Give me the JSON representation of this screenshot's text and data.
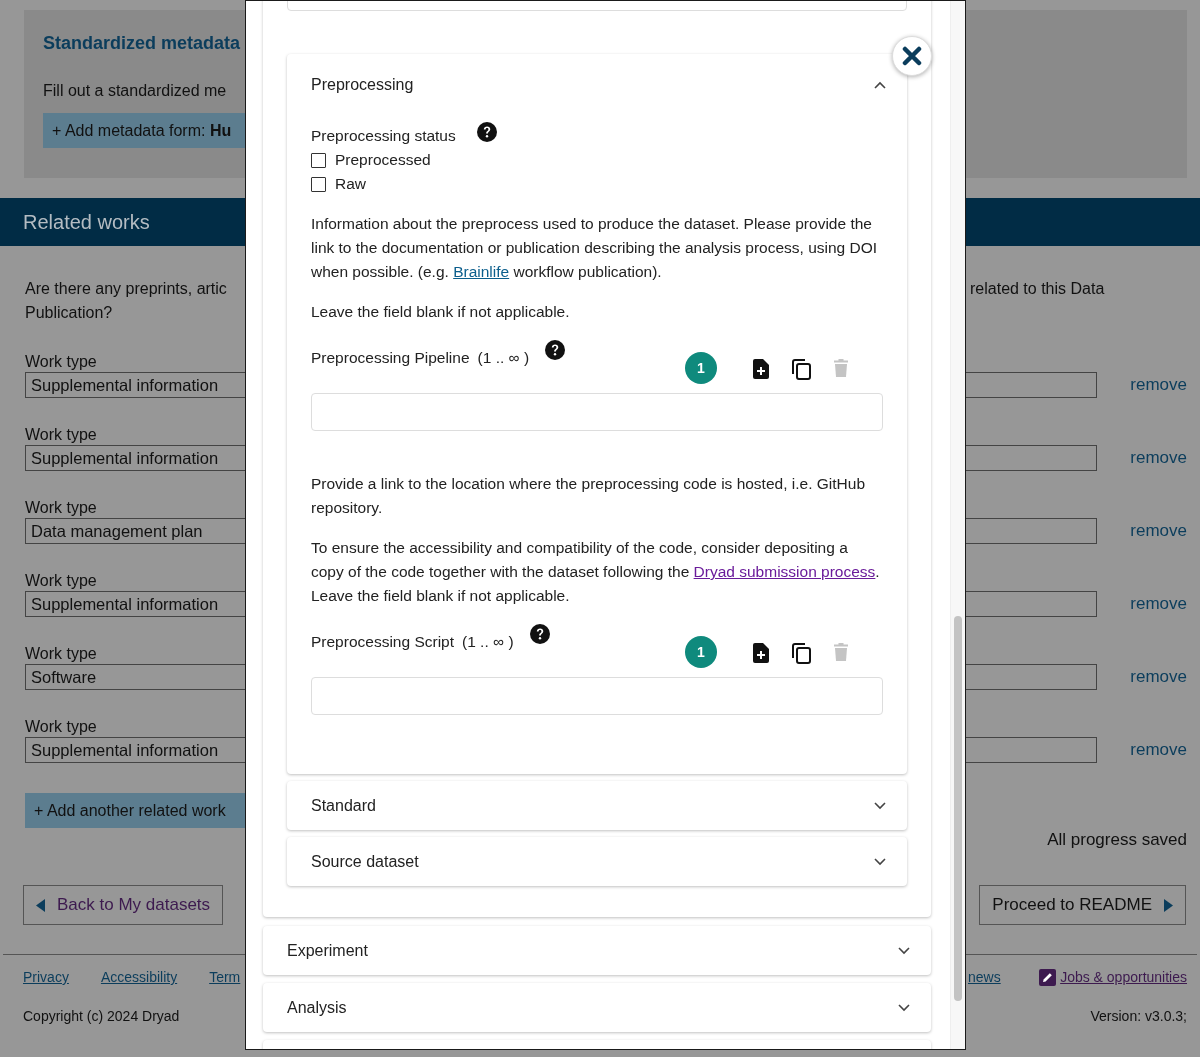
{
  "background": {
    "metadata": {
      "title": "Standardized metadata",
      "description": "Fill out a standardized me",
      "add_button": "+ Add metadata form: **Hu**"
    },
    "related_works": {
      "heading": "Related works",
      "question_start": "Are there any preprints, artic",
      "question_end": "related to this Data",
      "question_line2": "Publication?",
      "works": [
        {
          "label": "Work type",
          "value": "Supplemental information",
          "action": "remove"
        },
        {
          "label": "Work type",
          "value": "Supplemental information",
          "action": "remove"
        },
        {
          "label": "Work type",
          "value": "Data management plan",
          "action": "remove"
        },
        {
          "label": "Work type",
          "value": "Supplemental information",
          "action": "remove"
        },
        {
          "label": "Work type",
          "value": "Software",
          "action": "remove"
        },
        {
          "label": "Work type",
          "value": "Supplemental information",
          "action": "remove"
        }
      ],
      "add_button": "+ Add another related work"
    },
    "save_status": "All progress saved",
    "back_button": "Back to My datasets",
    "proceed_button": "Proceed to README"
  },
  "footer": {
    "links_left": [
      "Privacy",
      "Accessibility",
      "Term"
    ],
    "links_right": [
      {
        "label": "news",
        "kind": "text"
      },
      {
        "label": "Jobs & opportunities",
        "kind": "icon"
      }
    ],
    "copyright": "Copyright (c) 2024 Dryad",
    "version": "Version: v3.0.3;"
  },
  "modal": {
    "panel": {
      "subsections": [
        {
          "title": "Preprocessing",
          "expanded": true,
          "blocks": [
            {
              "kind": "checkbox_group",
              "label": "Preprocessing status",
              "options": [
                {
                  "label": "Preprocessed",
                  "checked": false
                },
                {
                  "label": "Raw",
                  "checked": false
                }
              ]
            },
            {
              "kind": "paragraph",
              "parts": [
                {
                  "text": "Information about the preprocess used to produce the dataset. Please provide the link to the documentation or publication describing the analysis process, using DOI when possible. (e.g. "
                },
                {
                  "link": "Brainlife",
                  "visited": false
                },
                {
                  "text": " workflow publication)."
                }
              ]
            },
            {
              "kind": "paragraph",
              "parts": [
                {
                  "text": "Leave the field blank if not applicable."
                }
              ]
            },
            {
              "kind": "field",
              "label": "Preprocessing Pipeline",
              "cardinality": "(1 .. ∞ )",
              "count": "1",
              "delete_disabled": true
            },
            {
              "kind": "paragraph",
              "parts": [
                {
                  "text": "Provide a link to the location where the preprocessing code is hosted, i.e. GitHub repository."
                }
              ]
            },
            {
              "kind": "paragraph",
              "parts": [
                {
                  "text": "To ensure the accessibility and compatibility of the code, consider depositing a copy of the code together with the dataset following the "
                },
                {
                  "link": "Dryad submission process",
                  "visited": true
                },
                {
                  "text": ".  Leave the field blank if not applicable."
                }
              ]
            },
            {
              "kind": "field",
              "label": "Preprocessing Script",
              "cardinality": "(1 .. ∞ )",
              "count": "1",
              "delete_disabled": true
            }
          ]
        },
        {
          "title": "Standard",
          "expanded": false
        },
        {
          "title": "Source dataset",
          "expanded": false
        }
      ]
    },
    "sections": [
      {
        "title": "Experiment",
        "expanded": false
      },
      {
        "title": "Analysis",
        "expanded": false
      }
    ]
  }
}
